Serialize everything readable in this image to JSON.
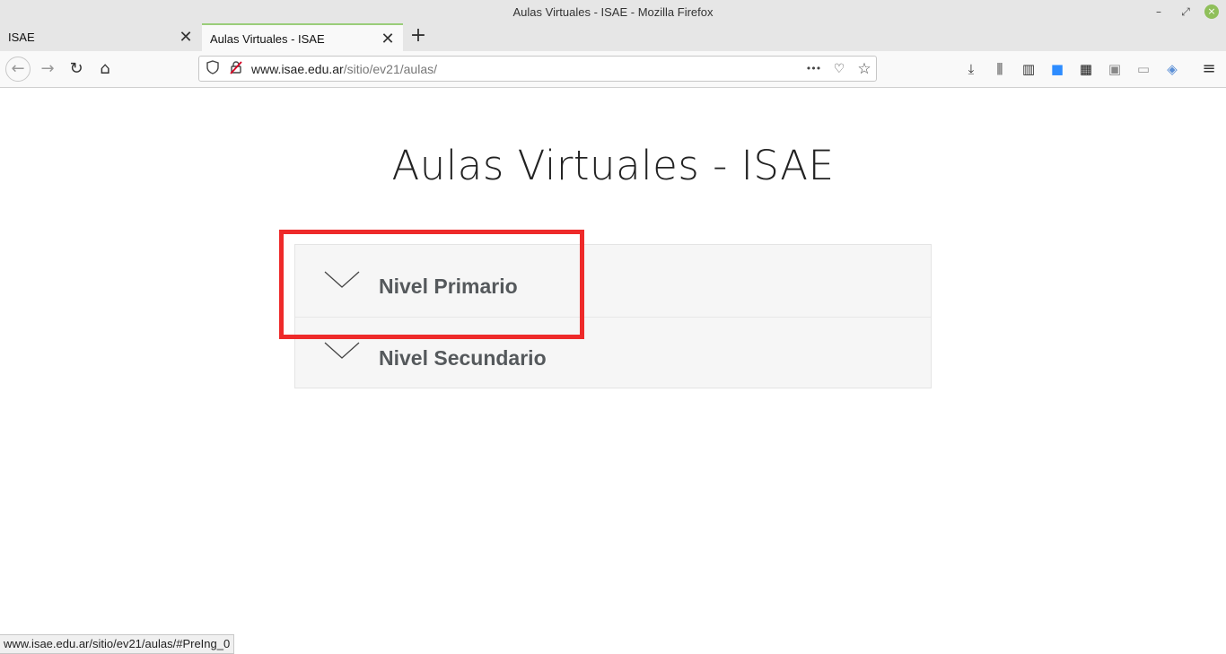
{
  "window": {
    "title": "Aulas Virtuales - ISAE - Mozilla Firefox",
    "controls": {
      "minimize": "–",
      "restore": "⤢",
      "close": "×"
    }
  },
  "tabs": [
    {
      "label": "ISAE",
      "close": "✕",
      "active": false
    },
    {
      "label": "Aulas Virtuales - ISAE",
      "close": "✕",
      "active": true
    }
  ],
  "new_tab": "+",
  "navbar": {
    "back": "←",
    "forward": "→",
    "reload": "↻",
    "home": "⌂",
    "url_host": "www.isae.edu.ar",
    "url_path": "/sitio/ev21/aulas/",
    "page_actions": "•••",
    "pocket": "♡",
    "bookmark": "☆",
    "tools": {
      "downloads": "⤓",
      "library": "⫼",
      "sidebar": "▥",
      "zoom_ext": "■",
      "ext_grid": "▦",
      "ext_avatar": "▣",
      "ext_screenshot": "▭",
      "ext_translate": "◈",
      "menu": "≡"
    }
  },
  "page": {
    "title": "Aulas Virtuales - ISAE",
    "accordion": [
      {
        "label": "Nivel Primario"
      },
      {
        "label": "Nivel Secundario"
      }
    ]
  },
  "status": {
    "url": "www.isae.edu.ar/sitio/ev21/aulas/#PreIng_0"
  },
  "colors": {
    "highlight": "#ee2a2a",
    "accordion_bg": "#f6f6f6",
    "accordion_text": "#55595c",
    "active_tab_accent": "#9acd7a"
  }
}
